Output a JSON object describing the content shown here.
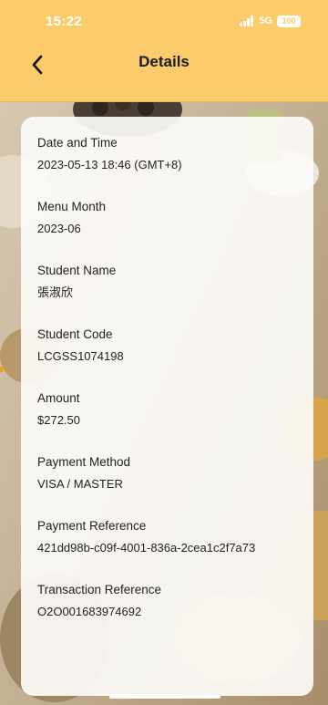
{
  "status_bar": {
    "time": "15:22",
    "network": "5G",
    "battery": "100"
  },
  "header": {
    "title": "Details",
    "back_icon": "chevron-left-icon"
  },
  "details": {
    "fields": [
      {
        "label": "Date and Time",
        "value": "2023-05-13 18:46 (GMT+8)"
      },
      {
        "label": "Menu Month",
        "value": "2023-06"
      },
      {
        "label": "Student Name",
        "value": "張淑欣"
      },
      {
        "label": "Student Code",
        "value": "LCGSS1074198"
      },
      {
        "label": "Amount",
        "value": "$272.50"
      },
      {
        "label": "Payment Method",
        "value": "VISA / MASTER"
      },
      {
        "label": "Payment Reference",
        "value": "421dd98b-c09f-4001-836a-2cea1c2f7a73"
      },
      {
        "label": "Transaction Reference",
        "value": "O2O001683974692"
      }
    ]
  },
  "colors": {
    "header_bg": "#fccb6b",
    "text": "#222222",
    "card_bg": "#fcfbf8"
  }
}
